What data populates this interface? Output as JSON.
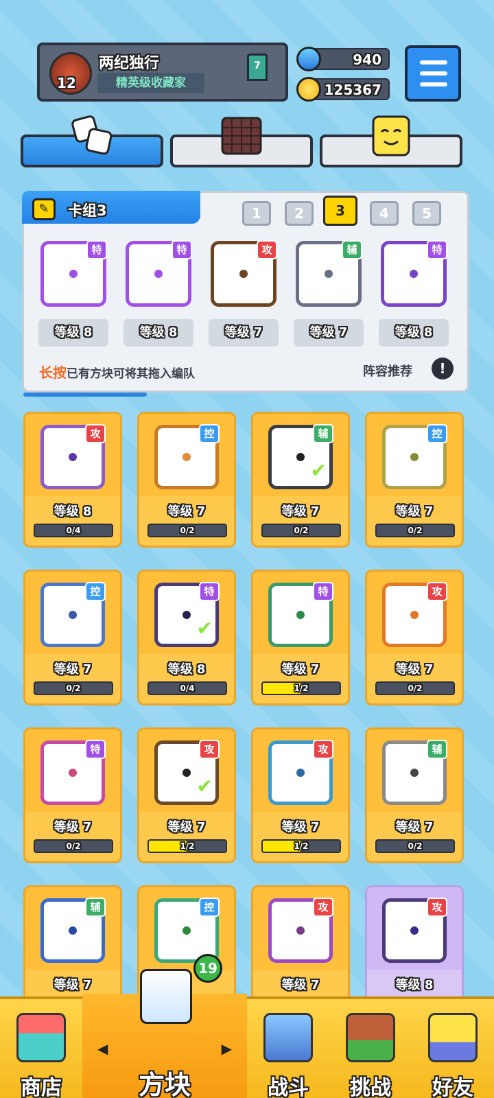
{
  "player": {
    "name": "两纪独行",
    "title": "精英级收藏家",
    "level": "12",
    "rank": "7"
  },
  "currency": {
    "gems": "940",
    "coins": "125367"
  },
  "top_tabs": [
    "dice-tab",
    "board-tab",
    "emote-tab"
  ],
  "deck": {
    "title": "卡组3",
    "tabs": [
      "1",
      "2",
      "3",
      "4",
      "5"
    ],
    "active_tab": "3",
    "slots": [
      {
        "level": "等级 8",
        "type": "特",
        "color": "#a050e6"
      },
      {
        "level": "等级 8",
        "type": "特",
        "color": "#a050e6"
      },
      {
        "level": "等级 7",
        "type": "攻",
        "color": "#6b4422"
      },
      {
        "level": "等级 7",
        "type": "辅",
        "color": "#6a6f85"
      },
      {
        "level": "等级 8",
        "type": "特",
        "color": "#7a44c8"
      }
    ],
    "hint_strong": "长按",
    "hint_rest": "已有方块可将其拖入编队",
    "recommend": "阵容推荐",
    "recommend_icon": "!"
  },
  "cards": [
    {
      "level": "等级 8",
      "progress": "0/4",
      "fill": 0,
      "type": "攻",
      "badge": "atk",
      "color": "#8a5cd0",
      "pip": "#5a3aa8",
      "check": false
    },
    {
      "level": "等级 7",
      "progress": "0/2",
      "fill": 0,
      "type": "控",
      "badge": "ctl",
      "color": "#c77a2a",
      "pip": "#e08a3a",
      "check": false
    },
    {
      "level": "等级 7",
      "progress": "0/2",
      "fill": 0,
      "type": "辅",
      "badge": "sup",
      "color": "#3a3d48",
      "pip": "#222",
      "check": true
    },
    {
      "level": "等级 7",
      "progress": "0/2",
      "fill": 0,
      "type": "控",
      "badge": "ctl",
      "color": "#b0a24a",
      "pip": "#8a8a3a",
      "check": false
    },
    {
      "level": "等级 7",
      "progress": "0/2",
      "fill": 0,
      "type": "控",
      "badge": "ctl",
      "color": "#4a78d0",
      "pip": "#3a5aa8",
      "check": false
    },
    {
      "level": "等级 8",
      "progress": "0/4",
      "fill": 0,
      "type": "特",
      "badge": "spc",
      "color": "#4a3a78",
      "pip": "#2a2050",
      "check": true
    },
    {
      "level": "等级 7",
      "progress": "1/2",
      "fill": 0.5,
      "type": "特",
      "badge": "spc",
      "color": "#3a9a6a",
      "pip": "#2a8a4a",
      "check": false
    },
    {
      "level": "等级 7",
      "progress": "0/2",
      "fill": 0,
      "type": "攻",
      "badge": "atk",
      "color": "#e07a2a",
      "pip": "#e07a2a",
      "check": false
    },
    {
      "level": "等级 7",
      "progress": "0/2",
      "fill": 0,
      "type": "特",
      "badge": "spc",
      "color": "#c84aa8",
      "pip": "#c84a7a",
      "check": false
    },
    {
      "level": "等级 7",
      "progress": "1/2",
      "fill": 0.5,
      "type": "攻",
      "badge": "atk",
      "color": "#6a4a2a",
      "pip": "#222",
      "check": true
    },
    {
      "level": "等级 7",
      "progress": "1/2",
      "fill": 0.5,
      "type": "攻",
      "badge": "atk",
      "color": "#3a9ad0",
      "pip": "#2a6aa8",
      "check": false
    },
    {
      "level": "等级 7",
      "progress": "0/2",
      "fill": 0,
      "type": "辅",
      "badge": "sup",
      "color": "#8a8a8a",
      "pip": "#444",
      "check": false
    },
    {
      "level": "等级 7",
      "progress": "",
      "fill": 0,
      "type": "辅",
      "badge": "sup",
      "color": "#3a6ad0",
      "pip": "#2a4aa8",
      "check": false
    },
    {
      "level": "",
      "progress": "",
      "fill": 0,
      "type": "控",
      "badge": "ctl",
      "color": "#3aa87a",
      "pip": "#2a8a3a",
      "check": false
    },
    {
      "level": "等级 7",
      "progress": "",
      "fill": 0,
      "type": "攻",
      "badge": "atk",
      "color": "#9a4ac8",
      "pip": "#7a3a8a",
      "check": false
    },
    {
      "level": "等级 8",
      "progress": "",
      "fill": 0,
      "type": "攻",
      "badge": "atk",
      "color": "#4a3a78",
      "pip": "#3a2a8a",
      "check": false,
      "lilac": true
    }
  ],
  "nav": {
    "shop": "商店",
    "dice": "方块",
    "battle": "战斗",
    "challenge": "挑战",
    "friends": "好友",
    "badge": "19"
  }
}
